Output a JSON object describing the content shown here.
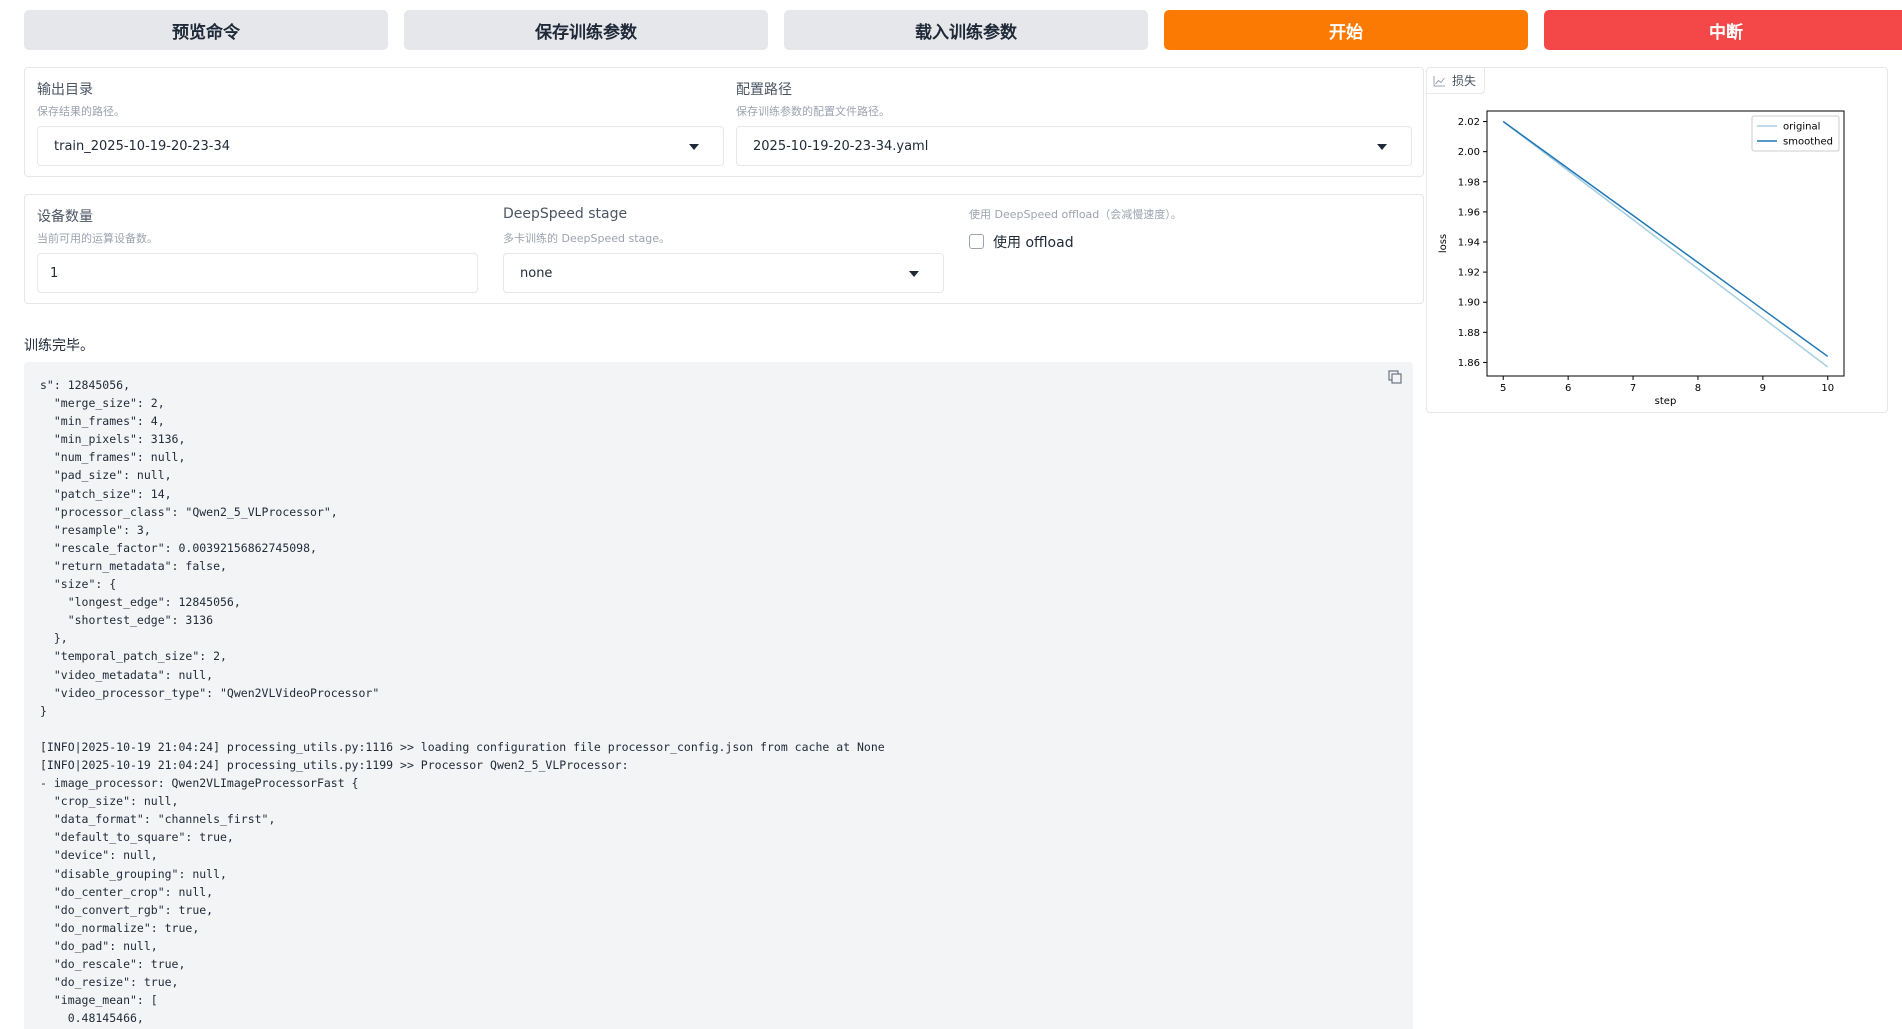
{
  "toolbar": {
    "preview_label": "预览命令",
    "save_label": "保存训练参数",
    "load_label": "载入训练参数",
    "start_label": "开始",
    "abort_label": "中断"
  },
  "output_dir": {
    "label": "输出目录",
    "info": "保存结果的路径。",
    "value": "train_2025-10-19-20-23-34"
  },
  "config_path": {
    "label": "配置路径",
    "info": "保存训练参数的配置文件路径。",
    "value": "2025-10-19-20-23-34.yaml"
  },
  "device_count": {
    "label": "设备数量",
    "info": "当前可用的运算设备数。",
    "value": "1"
  },
  "ds_stage": {
    "label": "DeepSpeed stage",
    "info": "多卡训练的 DeepSpeed stage。",
    "value": "none"
  },
  "ds_offload": {
    "label": "使用 DeepSpeed offload（会减慢速度）。",
    "checkbox_label": "使用 offload",
    "checked": false
  },
  "status_text": "训练完毕。",
  "log_text": "s\": 12845056,\n  \"merge_size\": 2,\n  \"min_frames\": 4,\n  \"min_pixels\": 3136,\n  \"num_frames\": null,\n  \"pad_size\": null,\n  \"patch_size\": 14,\n  \"processor_class\": \"Qwen2_5_VLProcessor\",\n  \"resample\": 3,\n  \"rescale_factor\": 0.00392156862745098,\n  \"return_metadata\": false,\n  \"size\": {\n    \"longest_edge\": 12845056,\n    \"shortest_edge\": 3136\n  },\n  \"temporal_patch_size\": 2,\n  \"video_metadata\": null,\n  \"video_processor_type\": \"Qwen2VLVideoProcessor\"\n}\n\n[INFO|2025-10-19 21:04:24] processing_utils.py:1116 >> loading configuration file processor_config.json from cache at None\n[INFO|2025-10-19 21:04:24] processing_utils.py:1199 >> Processor Qwen2_5_VLProcessor:\n- image_processor: Qwen2VLImageProcessorFast {\n  \"crop_size\": null,\n  \"data_format\": \"channels_first\",\n  \"default_to_square\": true,\n  \"device\": null,\n  \"disable_grouping\": null,\n  \"do_center_crop\": null,\n  \"do_convert_rgb\": true,\n  \"do_normalize\": true,\n  \"do_pad\": null,\n  \"do_rescale\": true,\n  \"do_resize\": true,\n  \"image_mean\": [\n    0.48145466,",
  "chart_panel": {
    "tab_label": "损失",
    "icon": "line-chart-icon"
  },
  "chart_data": {
    "type": "line",
    "xlabel": "step",
    "ylabel": "loss",
    "x": [
      5,
      10
    ],
    "xticks": [
      5,
      6,
      7,
      8,
      9,
      10
    ],
    "yticks": [
      1.86,
      1.88,
      1.9,
      1.92,
      1.94,
      1.96,
      1.98,
      2.0,
      2.02
    ],
    "xlim": [
      4.75,
      10.25
    ],
    "ylim": [
      1.851,
      2.027
    ],
    "legend_position": "upper-right",
    "grid": false,
    "series": [
      {
        "name": "original",
        "x": [
          5,
          10
        ],
        "values": [
          2.02,
          1.857
        ],
        "color": "#a6cee3"
      },
      {
        "name": "smoothed",
        "x": [
          5,
          10
        ],
        "values": [
          2.02,
          1.864
        ],
        "color": "#1f77b4"
      }
    ]
  },
  "colors": {
    "start_button": "#fb7a04",
    "abort_button": "#f44848",
    "gray_button": "#e5e7eb"
  }
}
